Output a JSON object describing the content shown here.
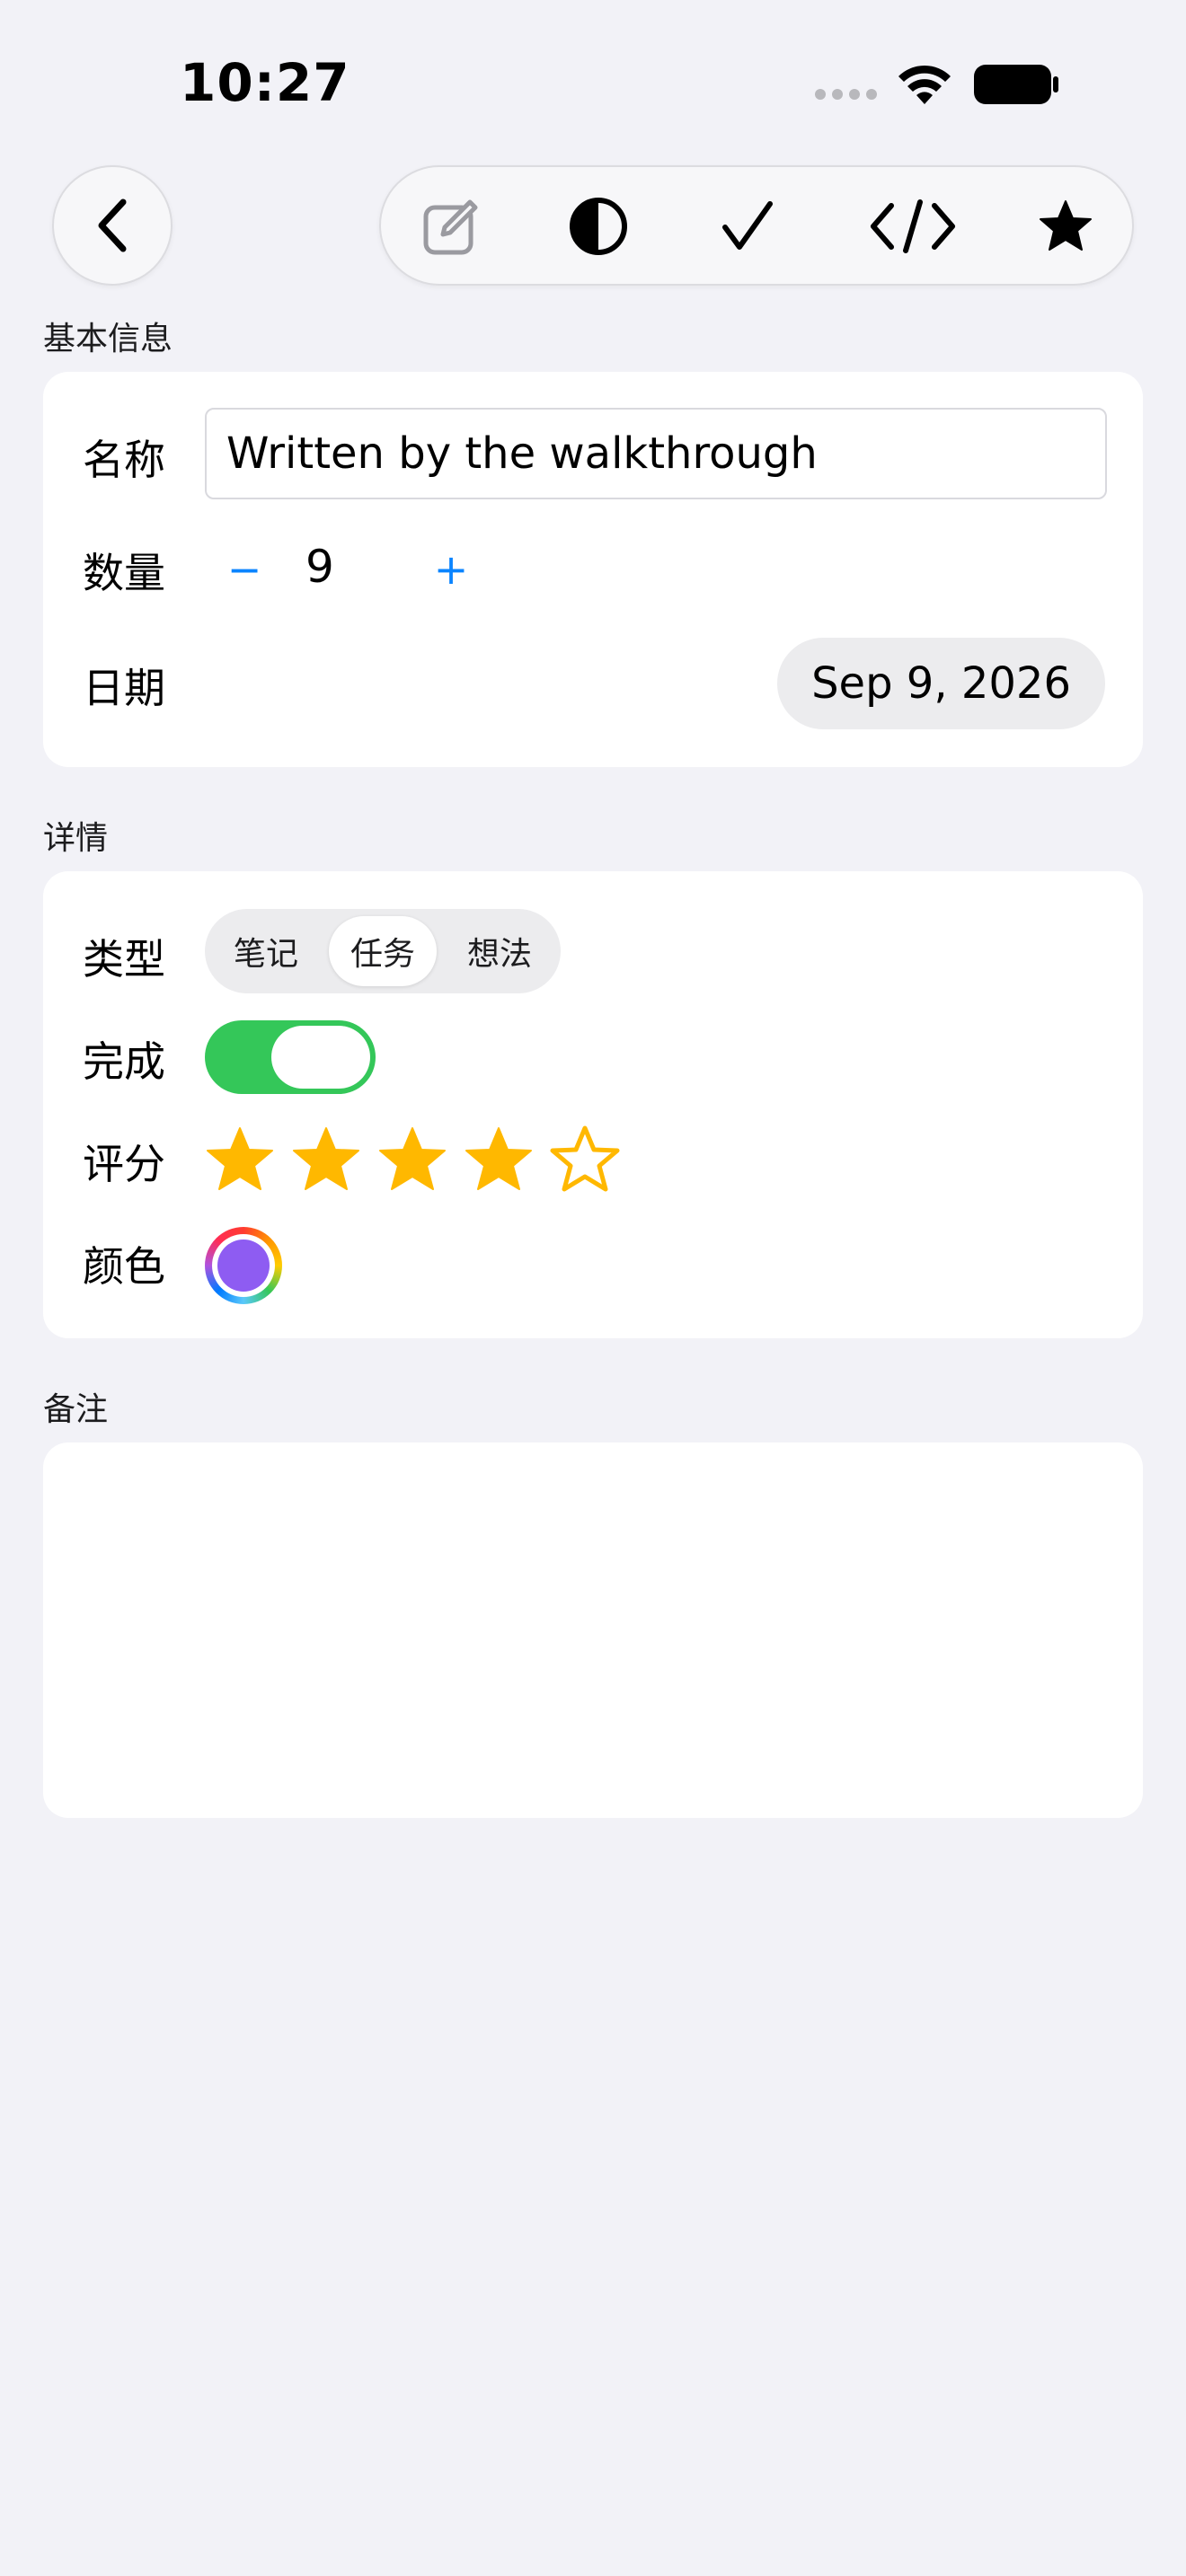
{
  "status_bar": {
    "time": "10:27"
  },
  "nav": {
    "back_icon": "chevron-left-icon",
    "toolbar_icons": [
      "edit-icon",
      "contrast-icon",
      "checkmark-icon",
      "code-icon",
      "star-fill-icon"
    ]
  },
  "sections": {
    "basic_info": {
      "header": "基本信息",
      "name_label": "名称",
      "name_value": "Written by the walkthrough",
      "quantity_label": "数量",
      "quantity_minus": "−",
      "quantity_value": "9",
      "quantity_plus": "+",
      "date_label": "日期",
      "date_value": "Sep 9, 2026"
    },
    "details": {
      "header": "详情",
      "type_label": "类型",
      "type_options": [
        "笔记",
        "任务",
        "想法"
      ],
      "type_selected": "任务",
      "done_label": "完成",
      "done_on": true,
      "rating_label": "评分",
      "rating_value": 4,
      "rating_max": 5,
      "color_label": "颜色",
      "color_value": "#8e5cf2"
    },
    "notes": {
      "header": "备注",
      "value": ""
    }
  },
  "colors": {
    "background": "#f2f2f7",
    "card": "#ffffff",
    "accent": "#0a84ff",
    "toggle_on": "#34c759",
    "star": "#ffb800"
  }
}
